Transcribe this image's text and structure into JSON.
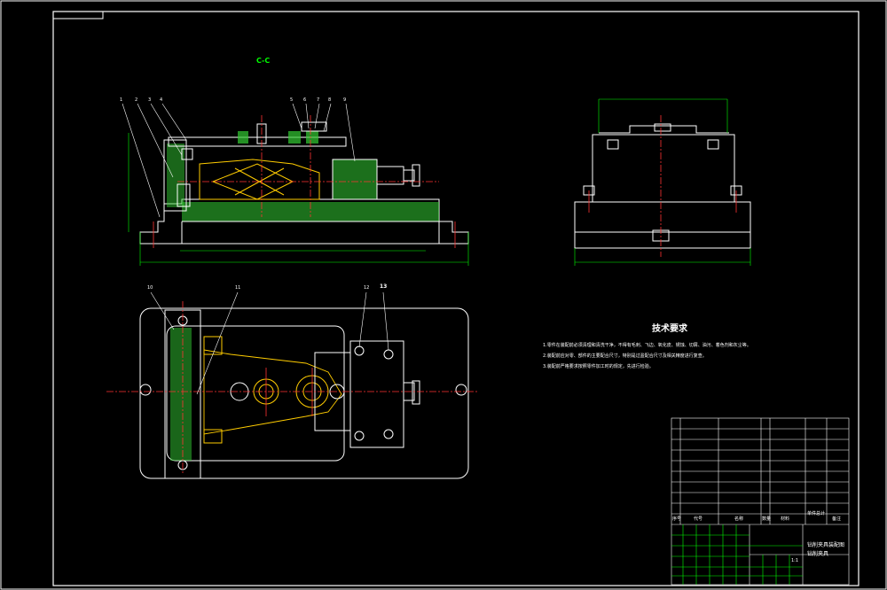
{
  "section_label": "C-C",
  "tech_req": {
    "title": "技术要求",
    "lines": [
      "1.零件在装配前必须清理和清洗干净，不得有毛刺、飞边、氧化皮、锈蚀、切屑、油污、着色剂和灰尘等。",
      "2.装配前应对零、部件的主要配合尺寸，特别是过盈配合尺寸及相关精度进行复查。",
      "3.装配前严格要求按照零件加工时的规定，先进行检验。"
    ]
  },
  "balloons_front": [
    "1",
    "2",
    "3",
    "4",
    "5",
    "6",
    "7",
    "8",
    "9"
  ],
  "balloons_plan": [
    "10",
    "11",
    "12",
    "13"
  ],
  "title_block": {
    "name_lines": [
      "钻削夹具装配图",
      "钻削夹具"
    ],
    "header": [
      "序号",
      "代号",
      "名称",
      "数量",
      "材料",
      "单件",
      "总计",
      "备注"
    ],
    "sheet": "1:1"
  }
}
